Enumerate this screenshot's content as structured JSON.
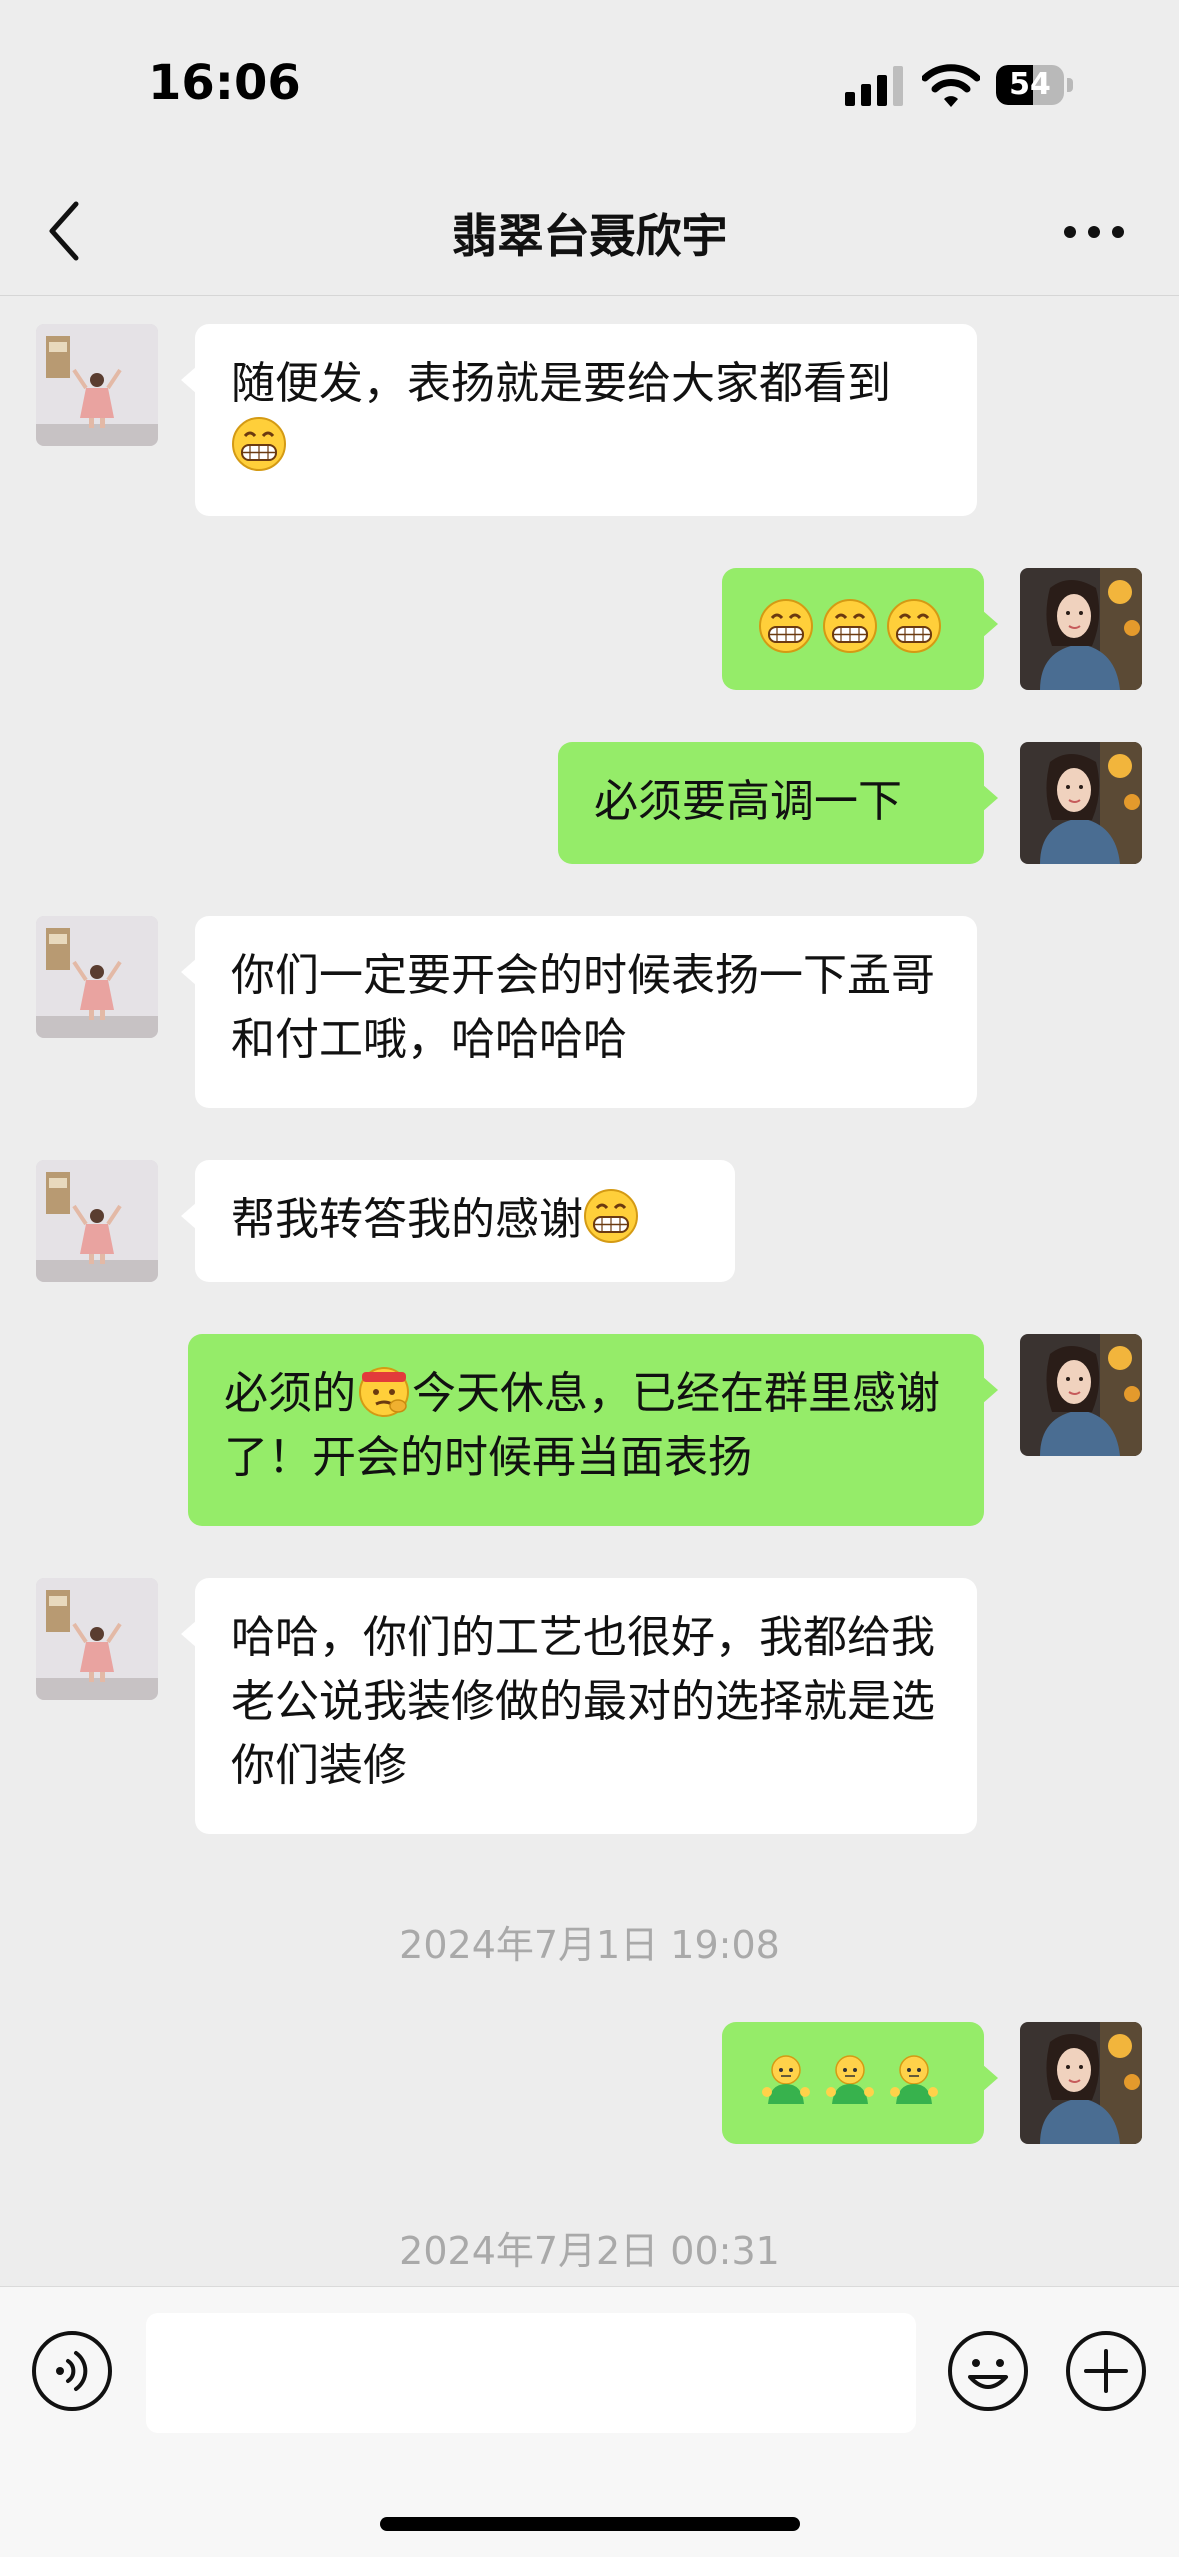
{
  "status_bar": {
    "time": "16:06",
    "battery_level": "54"
  },
  "header": {
    "title": "翡翠台聂欣宇",
    "back_icon": "chevron-left-icon",
    "more_icon": "ellipsis-icon"
  },
  "messages": [
    {
      "side": "left",
      "text": "随便发，表扬就是要给大家都看到",
      "emoji": "grin"
    },
    {
      "side": "right",
      "emoji": "grin x3"
    },
    {
      "side": "right",
      "text": "必须要高调一下"
    },
    {
      "side": "left",
      "text": "你们一定要开会的时候表扬一下孟哥和付工哦，哈哈哈哈"
    },
    {
      "side": "left",
      "text": "帮我转答我的感谢",
      "emoji": "grin"
    },
    {
      "side": "right",
      "text_a": "必须的",
      "emoji": "thinking-bandage",
      "text_b": "今天休息，已经在群里感谢了！开会的时候再当面表扬"
    },
    {
      "side": "left",
      "text": "哈哈，你们的工艺也很好，我都给我老公说我装修做的最对的选择就是选你们装修"
    },
    {
      "type": "timestamp",
      "text": "2024年7月1日 19:08"
    },
    {
      "side": "right",
      "emoji": "green-figure x3"
    },
    {
      "type": "timestamp",
      "text": "2024年7月2日 00:31"
    }
  ],
  "input_bar": {
    "placeholder": "",
    "voice_icon": "voice-icon",
    "emoji_icon": "smiley-icon",
    "plus_icon": "plus-circle-icon"
  },
  "colors": {
    "background": "#ededed",
    "own_bubble": "#95ec69",
    "other_bubble": "#ffffff",
    "timestamp": "#a9a9a9"
  }
}
